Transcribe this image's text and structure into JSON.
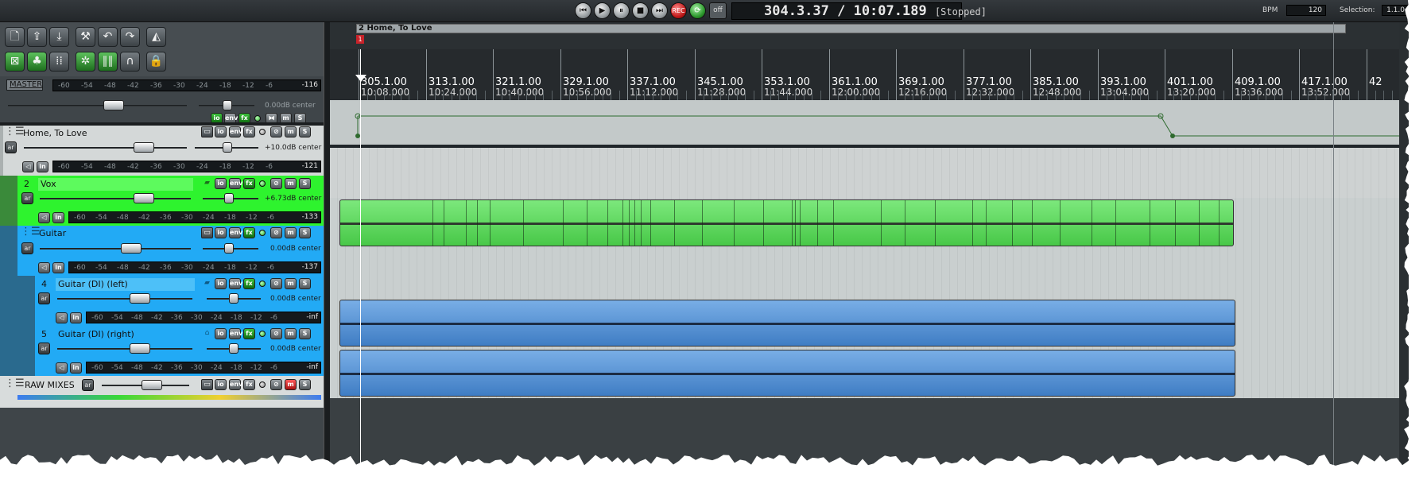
{
  "transport": {
    "buttons": [
      "⏮",
      "▶",
      "⏸",
      "■",
      "⏭"
    ],
    "rec_label": "REC",
    "off_label": "off",
    "position": "304.3.37 / 10:07.189",
    "state": "[Stopped]",
    "bpm_label": "BPM",
    "bpm": "120",
    "selection_label": "Selection:",
    "selection": "1.1.0"
  },
  "master": {
    "label": "MASTER",
    "meter_ticks": [
      "-60",
      "-54",
      "-48",
      "-42",
      "-36",
      "-30",
      "-24",
      "-18",
      "-12",
      "-6"
    ],
    "peak": "-116",
    "volume": "0.00dB center",
    "buttons": {
      "io": "io",
      "env": "env",
      "fx": "fx",
      "mute": "m",
      "solo": "S"
    }
  },
  "tracks": [
    {
      "number": "",
      "name": "Home, To Love",
      "volume": "+10.0dB center",
      "peak": "-121",
      "color": "#e0e3e3"
    },
    {
      "number": "2",
      "name": "Vox",
      "volume": "+6.73dB center",
      "peak": "-133",
      "color": "#2ef32e"
    },
    {
      "number": "",
      "name": "Guitar",
      "volume": "0.00dB center",
      "peak": "-137",
      "color": "#22aaf5"
    },
    {
      "number": "4",
      "name": "Guitar (DI) (left)",
      "volume": "0.00dB center",
      "peak": "-inf",
      "color": "#22aaf5"
    },
    {
      "number": "5",
      "name": "Guitar (DI) (right)",
      "volume": "0.00dB center",
      "peak": "-inf",
      "color": "#22aaf5"
    },
    {
      "number": "",
      "name": "RAW MIXES",
      "volume": "",
      "peak": "",
      "color": "#d8dcdc"
    }
  ],
  "region": {
    "name": "2 Home, To Love",
    "marker": "1"
  },
  "ruler": {
    "bars": [
      "305.1.00",
      "313.1.00",
      "321.1.00",
      "329.1.00",
      "337.1.00",
      "345.1.00",
      "353.1.00",
      "361.1.00",
      "369.1.00",
      "377.1.00",
      "385.1.00",
      "393.1.00",
      "401.1.00",
      "409.1.00",
      "417.1.00",
      "42"
    ],
    "times": [
      "10:08.000",
      "10:24.000",
      "10:40.000",
      "10:56.000",
      "11:12.000",
      "11:28.000",
      "11:44.000",
      "12:00.000",
      "12:16.000",
      "12:32.000",
      "12:48.000",
      "13:04.000",
      "13:20.000",
      "13:36.000",
      "13:52.000",
      ""
    ]
  },
  "track_labels": {
    "arm": "ar",
    "io": "io",
    "env": "env",
    "fx": "fx",
    "mute": "m",
    "solo": "S",
    "in": "in"
  },
  "colors": {
    "accent_green": "#2ef32e",
    "accent_blue": "#22aaf5",
    "item_green": "#5cd85c",
    "item_blue": "#5a96d8"
  }
}
